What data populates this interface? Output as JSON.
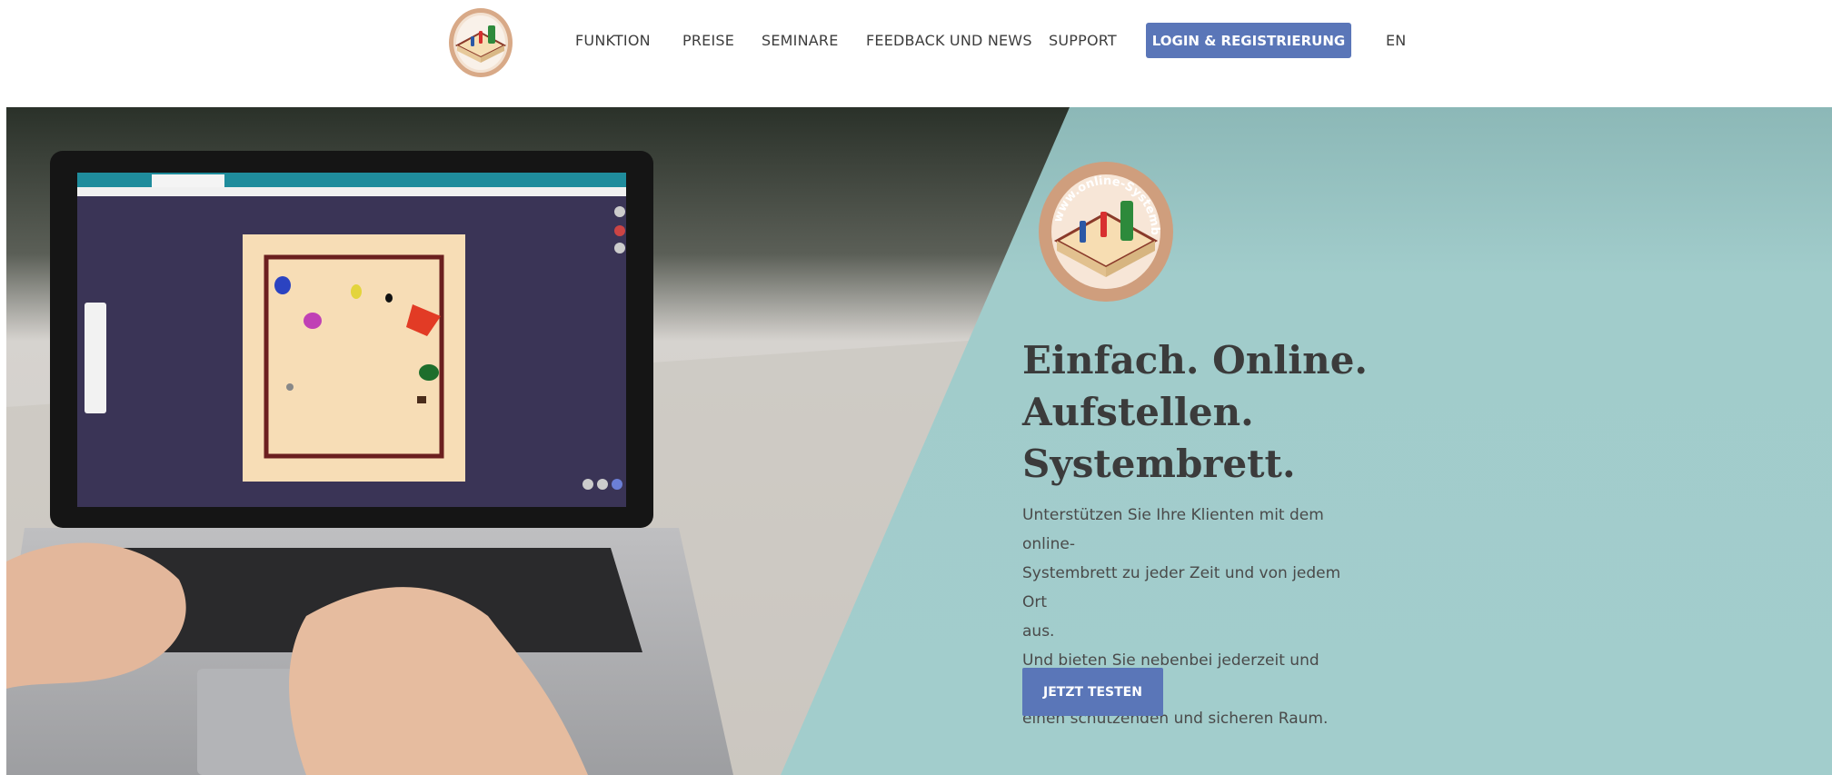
{
  "nav": {
    "logo_alt": "online-Systembrett logo",
    "items": [
      {
        "label": "FUNKTION"
      },
      {
        "label": "PREISE"
      },
      {
        "label": "SEMINARE"
      },
      {
        "label": "FEEDBACK UND NEWS"
      },
      {
        "label": "SUPPORT"
      }
    ],
    "login_label": "LOGIN & REGISTRIERUNG",
    "language_label": "EN"
  },
  "hero": {
    "logo_text": "www.online-Systembrett.com",
    "title_lines": [
      "Einfach. Online.",
      "Aufstellen.",
      "Systembrett."
    ],
    "text_lines": [
      "Unterstützen Sie Ihre Klienten mit dem online-",
      "Systembrett zu jeder Zeit und von jedem Ort",
      "aus.",
      "Und bieten Sie nebenbei jederzeit und überall",
      "einen schützenden und sicheren Raum."
    ],
    "cta_label": "JETZT TESTEN"
  },
  "colors": {
    "accent": "#5a76b8",
    "teal": "#a1cccb",
    "text_dark": "#3b3b3b"
  },
  "icons": [
    "logo-icon",
    "laptop-photo",
    "systemboard-screenshot"
  ]
}
